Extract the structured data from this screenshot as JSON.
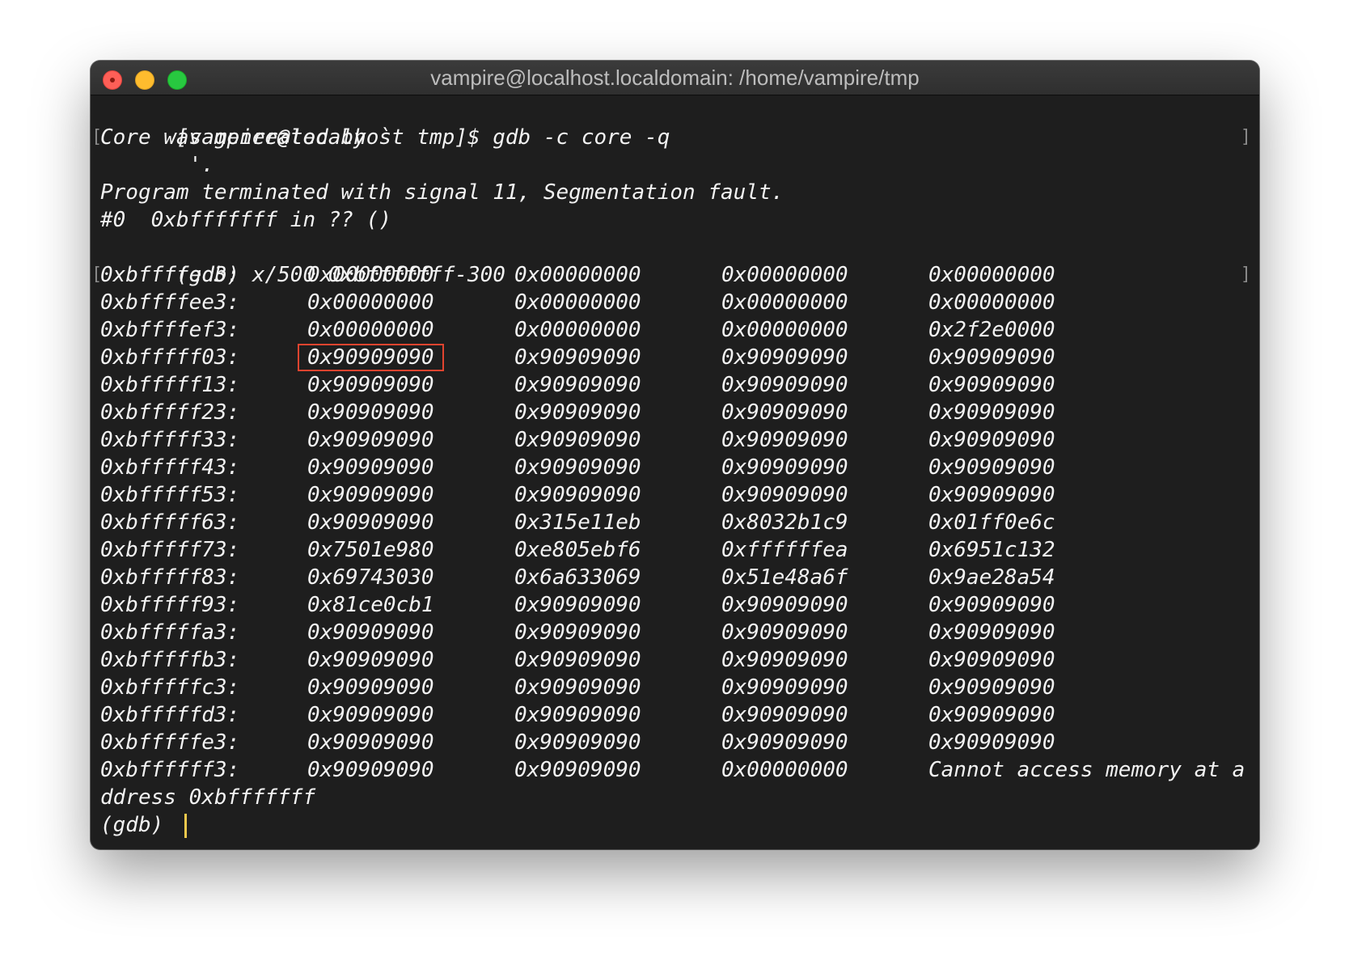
{
  "window": {
    "title": "vampire@localhost.localdomain: /home/vampire/tmp"
  },
  "terminal": {
    "prompt_line": "[vampire@localhost tmp]$ gdb -c core -q",
    "core_line_1": "Core was generated by `",
    "core_line_2": "       '.",
    "signal_line": "Program terminated with signal 11, Segmentation fault.",
    "frame_line": "#0  0xbfffffff in ?? ()",
    "gdb_command": "(gdb) x/500 0xbfffffff-300",
    "memory_rows": [
      {
        "addr": "0xbffffed3:",
        "words": [
          "0x00000000",
          "0x00000000",
          "0x00000000",
          "0x00000000"
        ]
      },
      {
        "addr": "0xbffffee3:",
        "words": [
          "0x00000000",
          "0x00000000",
          "0x00000000",
          "0x00000000"
        ]
      },
      {
        "addr": "0xbffffef3:",
        "words": [
          "0x00000000",
          "0x00000000",
          "0x00000000",
          "0x2f2e0000"
        ]
      },
      {
        "addr": "0xbfffff03:",
        "words": [
          "0x90909090",
          "0x90909090",
          "0x90909090",
          "0x90909090"
        ]
      },
      {
        "addr": "0xbfffff13:",
        "words": [
          "0x90909090",
          "0x90909090",
          "0x90909090",
          "0x90909090"
        ]
      },
      {
        "addr": "0xbfffff23:",
        "words": [
          "0x90909090",
          "0x90909090",
          "0x90909090",
          "0x90909090"
        ]
      },
      {
        "addr": "0xbfffff33:",
        "words": [
          "0x90909090",
          "0x90909090",
          "0x90909090",
          "0x90909090"
        ]
      },
      {
        "addr": "0xbfffff43:",
        "words": [
          "0x90909090",
          "0x90909090",
          "0x90909090",
          "0x90909090"
        ]
      },
      {
        "addr": "0xbfffff53:",
        "words": [
          "0x90909090",
          "0x90909090",
          "0x90909090",
          "0x90909090"
        ]
      },
      {
        "addr": "0xbfffff63:",
        "words": [
          "0x90909090",
          "0x315e11eb",
          "0x8032b1c9",
          "0x01ff0e6c"
        ]
      },
      {
        "addr": "0xbfffff73:",
        "words": [
          "0x7501e980",
          "0xe805ebf6",
          "0xffffffea",
          "0x6951c132"
        ]
      },
      {
        "addr": "0xbfffff83:",
        "words": [
          "0x69743030",
          "0x6a633069",
          "0x51e48a6f",
          "0x9ae28a54"
        ]
      },
      {
        "addr": "0xbfffff93:",
        "words": [
          "0x81ce0cb1",
          "0x90909090",
          "0x90909090",
          "0x90909090"
        ]
      },
      {
        "addr": "0xbfffffa3:",
        "words": [
          "0x90909090",
          "0x90909090",
          "0x90909090",
          "0x90909090"
        ]
      },
      {
        "addr": "0xbfffffb3:",
        "words": [
          "0x90909090",
          "0x90909090",
          "0x90909090",
          "0x90909090"
        ]
      },
      {
        "addr": "0xbfffffc3:",
        "words": [
          "0x90909090",
          "0x90909090",
          "0x90909090",
          "0x90909090"
        ]
      },
      {
        "addr": "0xbfffffd3:",
        "words": [
          "0x90909090",
          "0x90909090",
          "0x90909090",
          "0x90909090"
        ]
      },
      {
        "addr": "0xbfffffe3:",
        "words": [
          "0x90909090",
          "0x90909090",
          "0x90909090",
          "0x90909090"
        ]
      },
      {
        "addr": "0xbffffff3:",
        "words": [
          "0x90909090",
          "0x90909090",
          "0x00000000",
          "Cannot access memory at a"
        ]
      }
    ],
    "error_tail": "ddress 0xbfffffff",
    "final_prompt": "(gdb) ",
    "highlighted_cell": "0x90909090",
    "highlight_color": "#e2442f",
    "cursor_color": "#f2c94c"
  }
}
